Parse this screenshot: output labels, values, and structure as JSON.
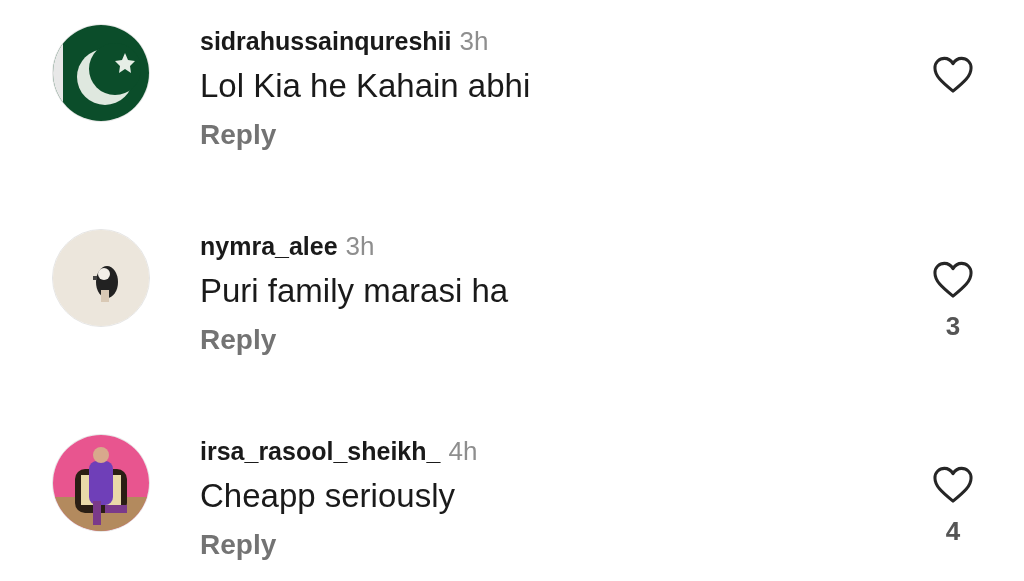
{
  "comments": [
    {
      "username": "sidrahussainqureshii",
      "time": "3h",
      "text": "Lol Kia he Kahain abhi",
      "reply": "Reply"
    },
    {
      "username": "nymra_alee",
      "time": "3h",
      "text": "Puri family marasi ha",
      "reply": "Reply",
      "likes": "3"
    },
    {
      "username": "irsa_rasool_sheikh_",
      "time": "4h",
      "text": "Cheapp seriously",
      "reply": "Reply",
      "likes": "4"
    }
  ]
}
